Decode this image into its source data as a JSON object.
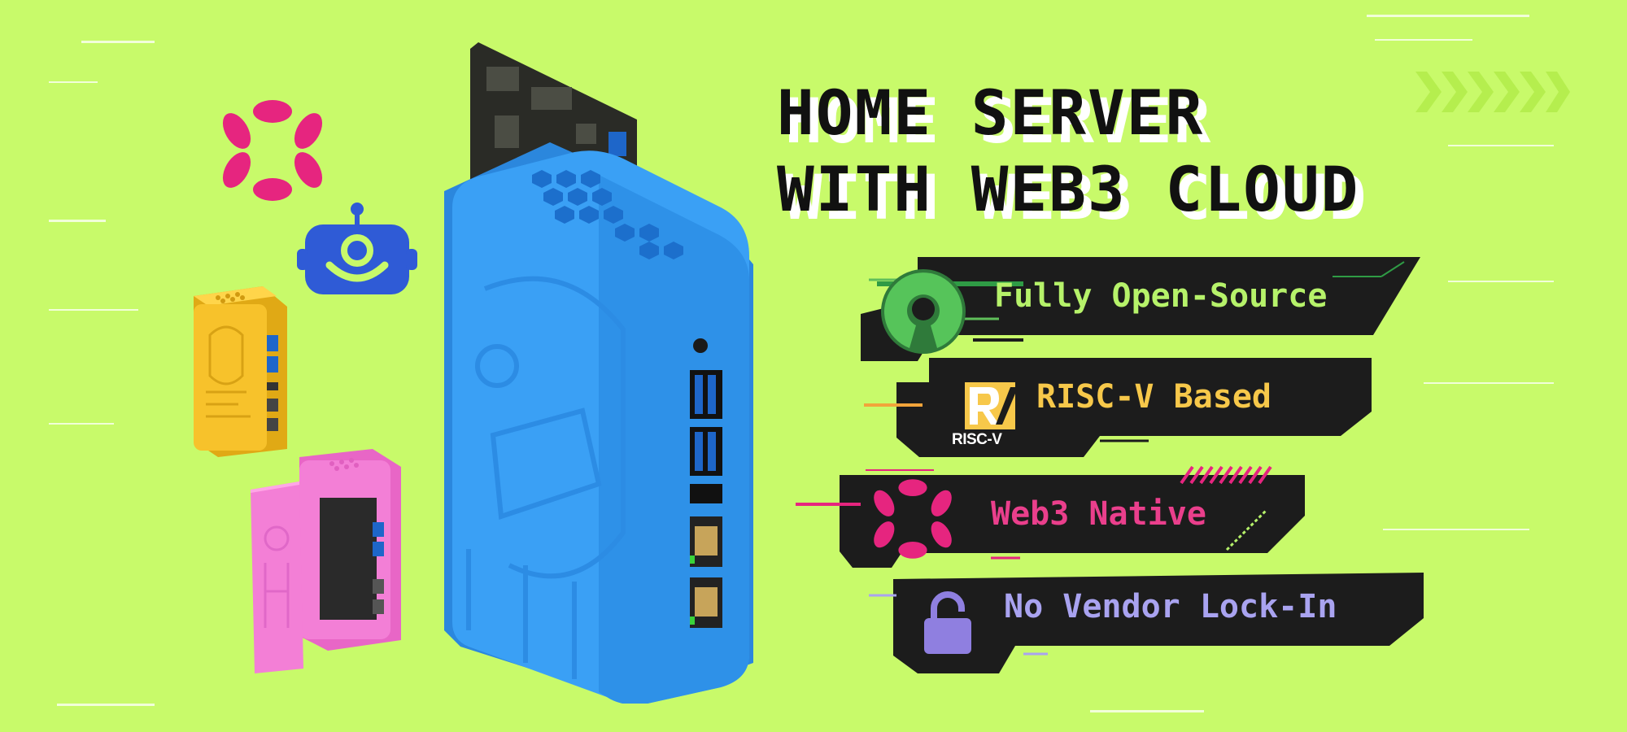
{
  "headline": {
    "line1": "HOME SERVER",
    "line2": "WITH WEB3 CLOUD"
  },
  "features": [
    {
      "label": "Fully Open-Source",
      "icon": "open-source-icon",
      "color": "#b6f26a"
    },
    {
      "label": "RISC-V Based",
      "icon": "risc-v-logo",
      "color": "#f7c84a"
    },
    {
      "label": "Web3 Native",
      "icon": "polkadot-icon",
      "color": "#ea3f8c"
    },
    {
      "label": "No Vendor Lock-In",
      "icon": "unlock-icon",
      "color": "#a9a3f0"
    }
  ],
  "risc_logo_text": "RISC-V",
  "colors": {
    "background": "#c8fa6a",
    "panel": "#1c1c1c",
    "case_blue": "#3aa0f5",
    "case_yellow": "#f7c22b",
    "case_pink": "#f37fd6",
    "polkadot_pink": "#e6257f",
    "robot_blue": "#2f5bd6"
  }
}
